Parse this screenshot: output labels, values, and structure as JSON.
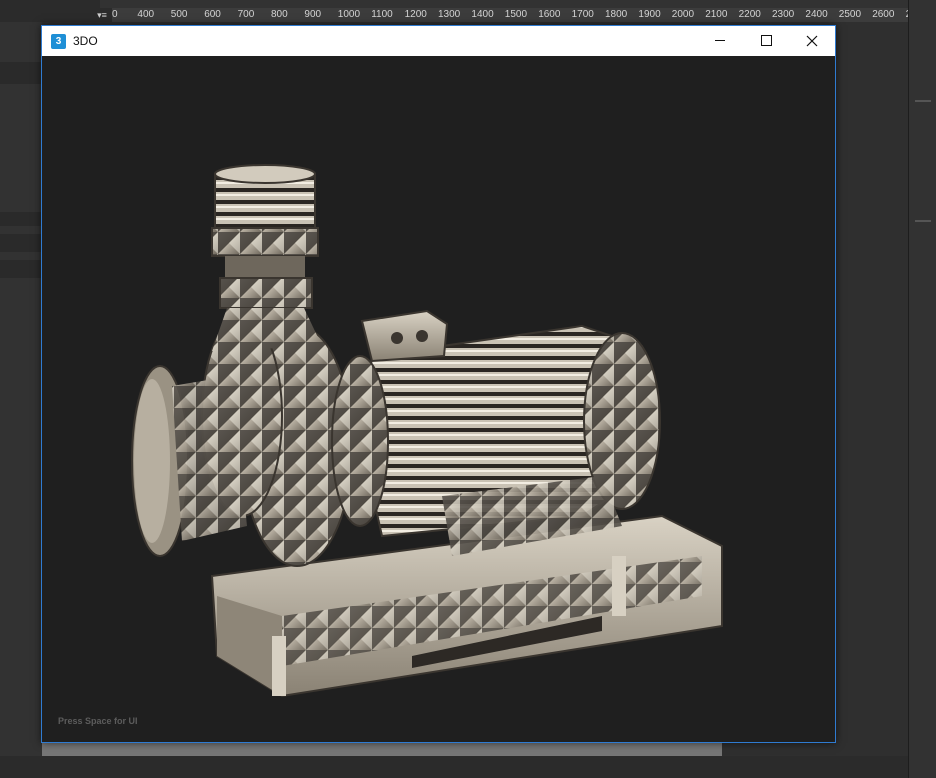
{
  "host": {
    "ruler_corner": "▾≡",
    "ruler_ticks": [
      "0",
      "400",
      "500",
      "600",
      "700",
      "800",
      "900",
      "1000",
      "1100",
      "1200",
      "1300",
      "1400",
      "1500",
      "1600",
      "1700",
      "1800",
      "1900",
      "2000",
      "2100",
      "2200",
      "2300",
      "2400",
      "2500",
      "2600",
      "2"
    ]
  },
  "window": {
    "app_icon": "3DO-app-icon",
    "title": "3DO",
    "icon_glyph": "3",
    "minimize_icon": "minimize-icon",
    "maximize_icon": "maximize-icon",
    "close_icon": "close-icon"
  },
  "viewport": {
    "hint": "Press Space for UI",
    "model": "3D pump motor assembly render"
  },
  "colors": {
    "window_border": "#2f7bd1",
    "viewport_bg": "#1f1f1f",
    "app_icon": "#1e8fd6"
  }
}
